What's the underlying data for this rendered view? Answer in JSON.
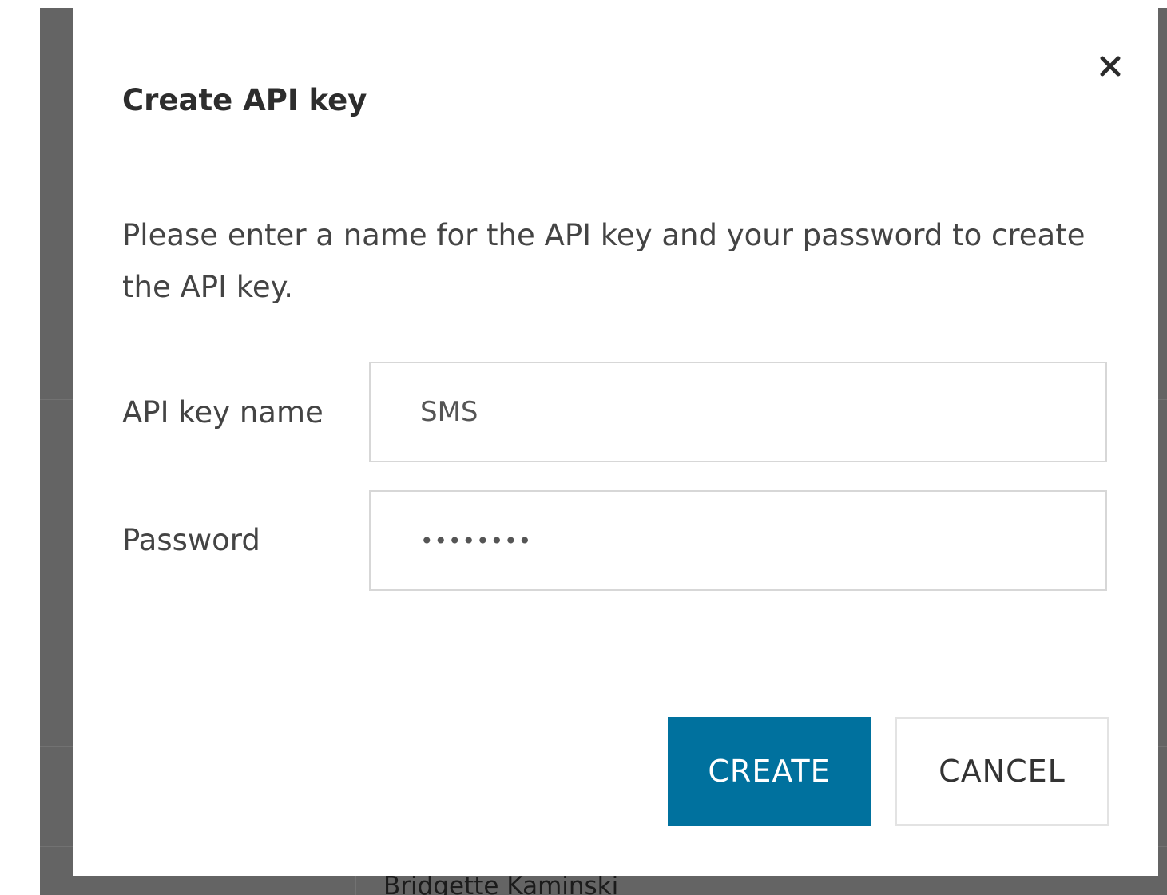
{
  "background": {
    "partial_row_text": "Bridgette Kaminski"
  },
  "dialog": {
    "title": "Create API key",
    "close_icon": "close-icon",
    "description": "Please enter a name for the API key and your password to create the API key.",
    "fields": {
      "api_key_name": {
        "label": "API key name",
        "value": "SMS"
      },
      "password": {
        "label": "Password",
        "value": "••••••••"
      }
    },
    "buttons": {
      "create": "CREATE",
      "cancel": "CANCEL"
    }
  },
  "colors": {
    "primary": "#00719e",
    "overlay": "#646464"
  }
}
